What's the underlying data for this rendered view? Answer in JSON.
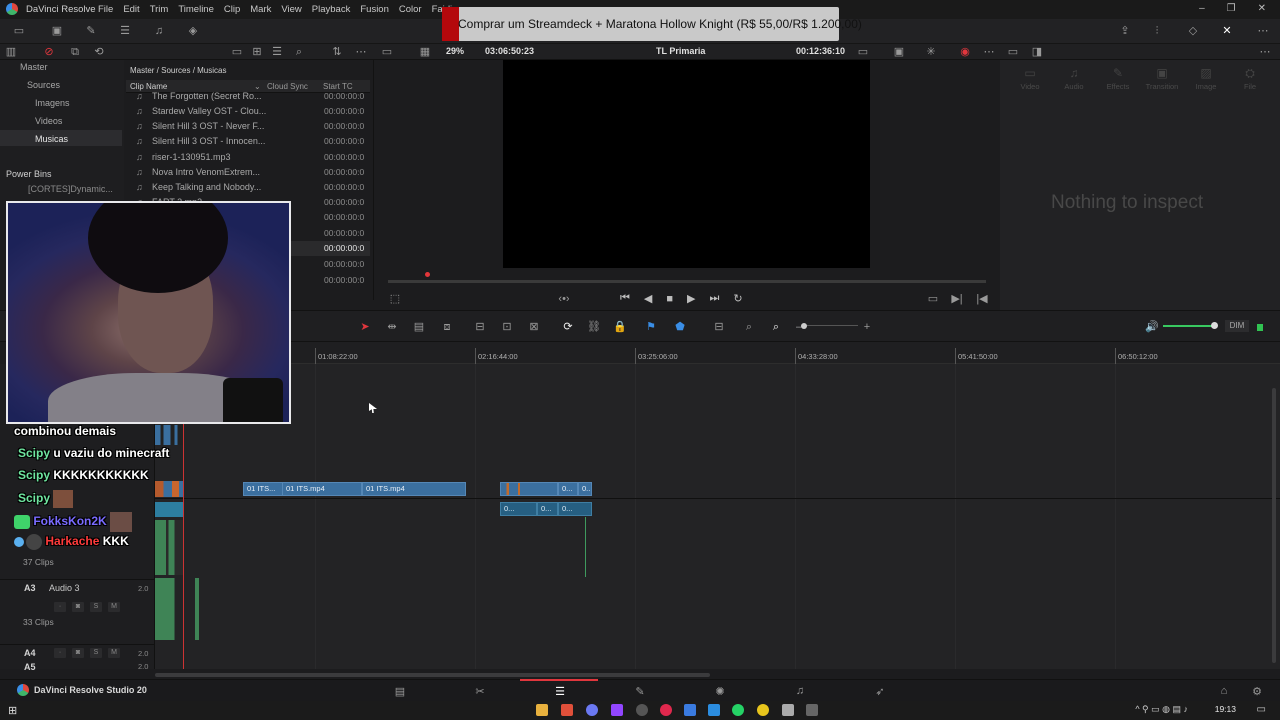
{
  "app": {
    "title": "DaVinci Resolve",
    "menu": [
      "File",
      "Edit",
      "Trim",
      "Timeline",
      "Clip",
      "Mark",
      "View",
      "Playback",
      "Fusion",
      "Color",
      "Fairlig"
    ],
    "product_name": "DaVinci Resolve Studio 20"
  },
  "overlay": {
    "donation_text": "Comprar um Streamdeck + Maratona Hollow Knight (R$ 55,00/R$ 1.200,00)"
  },
  "viewer": {
    "zoom": "29%",
    "source_timecode": "03:06:50:23",
    "timeline_name": "TL Primaria",
    "record_timecode": "00:12:36:10"
  },
  "bins": {
    "tree": [
      {
        "label": "Master"
      },
      {
        "label": "Sources"
      },
      {
        "label": "Imagens"
      },
      {
        "label": "Videos"
      },
      {
        "label": "Musicas",
        "selected": true
      }
    ],
    "power_bins_label": "Power Bins",
    "power_bin_item": "[CORTES]Dynamic..."
  },
  "media_pool": {
    "breadcrumb": "Master / Sources / Musicas",
    "columns": [
      "Clip Name",
      "Cloud Sync",
      "Start TC"
    ],
    "rows": [
      {
        "name": "The Forgotten (Secret Ro...",
        "tc": "00:00:00:0"
      },
      {
        "name": "Stardew Valley OST - Clou...",
        "tc": "00:00:00:0"
      },
      {
        "name": "Silent Hill 3 OST - Never F...",
        "tc": "00:00:00:0"
      },
      {
        "name": "Silent Hill 3 OST - Innocen...",
        "tc": "00:00:00:0"
      },
      {
        "name": "riser-1-130951.mp3",
        "tc": "00:00:00:0"
      },
      {
        "name": "Nova Intro VenomExtrem...",
        "tc": "00:00:00:0"
      },
      {
        "name": "Keep Talking and Nobody...",
        "tc": "00:00:00:0"
      },
      {
        "name": "FART 2.mp3",
        "tc": "00:00:00:0"
      },
      {
        "name": "",
        "tc": "00:00:00:0"
      },
      {
        "name": "",
        "tc": "00:00:00:0"
      },
      {
        "name": "",
        "tc": "00:00:00:0"
      },
      {
        "name": "",
        "tc": "00:00:00:0"
      },
      {
        "name": "",
        "tc": "00:00:00:0"
      }
    ]
  },
  "inspector": {
    "tabs": [
      "Video",
      "Audio",
      "Effects",
      "Transition",
      "Image",
      "File"
    ],
    "empty_text": "Nothing to inspect"
  },
  "timeline": {
    "ruler_ticks": [
      "01:08:22:00",
      "02:16:44:00",
      "03:25:06:00",
      "04:33:28:00",
      "05:41:50:00",
      "06:50:12:00"
    ],
    "video_clips": [
      "01 ITS...",
      "01 ITS.mp4",
      "01 ITS.mp4",
      "0...",
      "0..."
    ],
    "audio_clips": [
      "0...",
      "0...",
      "0..."
    ],
    "tracks": [
      {
        "id": "A3",
        "name": "Audio 3",
        "volume": "2.0",
        "clips": "33 Clips"
      },
      {
        "id": "A4",
        "name": "",
        "volume": "2.0"
      },
      {
        "id": "A5",
        "name": "",
        "volume": "2.0"
      }
    ],
    "a2_clips": "37 Clips",
    "dim_label": "DIM"
  },
  "chat": [
    {
      "user": "",
      "text": "combinou demais"
    },
    {
      "user": "Scipy",
      "text": "u vaziu do minecraft"
    },
    {
      "user": "Scipy",
      "text": "KKKKKKKKKKK"
    },
    {
      "user": "Scipy",
      "text": ""
    },
    {
      "user": "FokksKon2K",
      "text": ""
    },
    {
      "user": "Harkache",
      "text": "KKK"
    }
  ],
  "taskbar": {
    "time": "19:13"
  }
}
